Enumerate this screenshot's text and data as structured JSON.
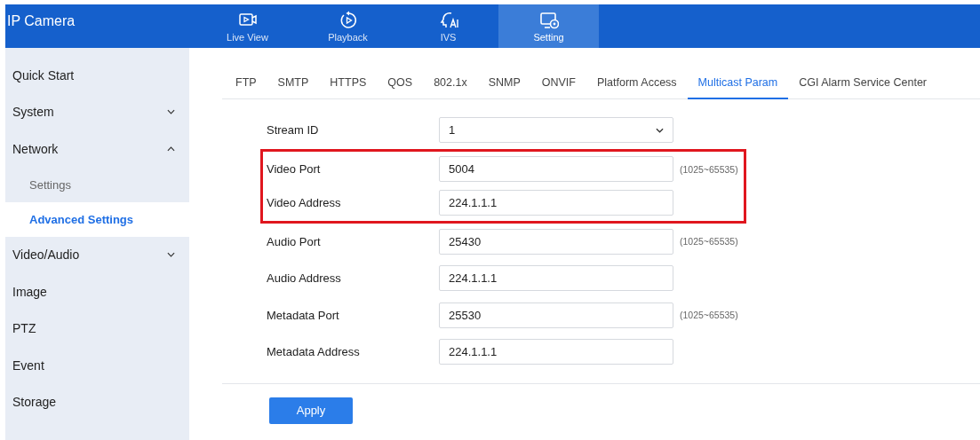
{
  "header": {
    "title": "IP Camera",
    "nav": [
      {
        "label": "Live View",
        "selected": false
      },
      {
        "label": "Playback",
        "selected": false
      },
      {
        "label": "IVS",
        "selected": false
      },
      {
        "label": "Setting",
        "selected": true
      }
    ]
  },
  "sidebar": {
    "items": [
      {
        "label": "Quick Start",
        "kind": "link"
      },
      {
        "label": "System",
        "kind": "group",
        "expanded": false
      },
      {
        "label": "Network",
        "kind": "group",
        "expanded": true,
        "children": [
          {
            "label": "Settings",
            "selected": false
          },
          {
            "label": "Advanced Settings",
            "selected": true
          }
        ]
      },
      {
        "label": "Video/Audio",
        "kind": "group",
        "expanded": false
      },
      {
        "label": "Image",
        "kind": "link"
      },
      {
        "label": "PTZ",
        "kind": "link"
      },
      {
        "label": "Event",
        "kind": "link"
      },
      {
        "label": "Storage",
        "kind": "link"
      }
    ]
  },
  "tabs": [
    {
      "label": "FTP",
      "selected": false
    },
    {
      "label": "SMTP",
      "selected": false
    },
    {
      "label": "HTTPS",
      "selected": false
    },
    {
      "label": "QOS",
      "selected": false
    },
    {
      "label": "802.1x",
      "selected": false
    },
    {
      "label": "SNMP",
      "selected": false
    },
    {
      "label": "ONVIF",
      "selected": false
    },
    {
      "label": "Platform Access",
      "selected": false
    },
    {
      "label": "Multicast Param",
      "selected": true
    },
    {
      "label": "CGI Alarm Service Center",
      "selected": false
    }
  ],
  "form": [
    {
      "label": "Stream ID",
      "kind": "select",
      "value": "1",
      "highlighted": false
    },
    {
      "label": "Video Port",
      "kind": "input",
      "value": "5004",
      "hint": "(1025~65535)",
      "highlighted": true
    },
    {
      "label": "Video Address",
      "kind": "input",
      "value": "224.1.1.1",
      "highlighted": true
    },
    {
      "label": "Audio Port",
      "kind": "input",
      "value": "25430",
      "hint": "(1025~65535)",
      "highlighted": false
    },
    {
      "label": "Audio Address",
      "kind": "input",
      "value": "224.1.1.1",
      "highlighted": false
    },
    {
      "label": "Metadata Port",
      "kind": "input",
      "value": "25530",
      "hint": "(1025~65535)",
      "highlighted": false
    },
    {
      "label": "Metadata Address",
      "kind": "input",
      "value": "224.1.1.1",
      "highlighted": false
    }
  ],
  "buttons": [
    {
      "label": "Apply"
    }
  ]
}
